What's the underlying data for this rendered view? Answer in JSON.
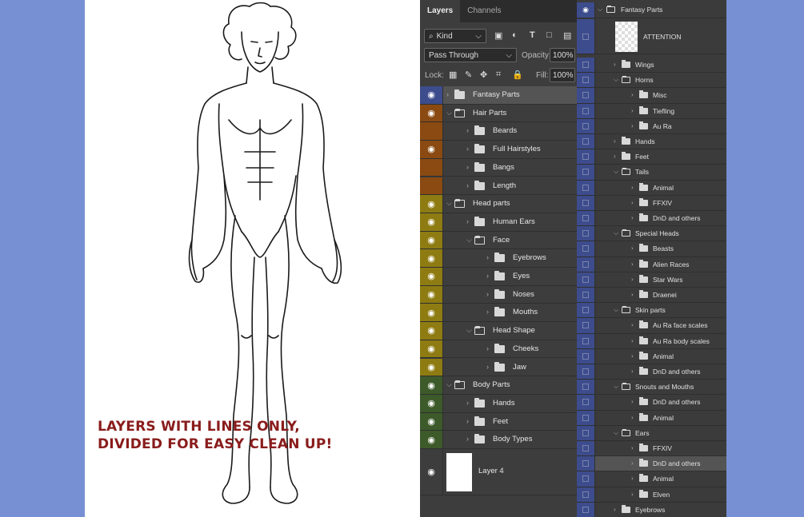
{
  "caption": {
    "line1": "LAYERS WITH LINES ONLY,",
    "line2": "DIVIDED FOR EASY CLEAN UP!"
  },
  "tabs": [
    "Layers",
    "Channels"
  ],
  "filter": {
    "kind": "Kind"
  },
  "blend": {
    "mode": "Pass Through",
    "opacity_label": "Opacity:",
    "opacity": "100%"
  },
  "lock": {
    "label": "Lock:",
    "fill_label": "Fill:",
    "fill": "100%"
  },
  "colors": {
    "blue": "#3d4c8c",
    "orange": "#8a4a12",
    "yellow": "#8e7c12",
    "green": "#3d5a2a"
  },
  "layers": [
    {
      "name": "Fantasy Parts",
      "depth": 0,
      "open": false,
      "color": "blue",
      "eye": true,
      "selected": true
    },
    {
      "name": "Hair Parts",
      "depth": 0,
      "open": true,
      "color": "orange",
      "eye": true
    },
    {
      "name": "Beards",
      "depth": 1,
      "open": false,
      "color": "orange",
      "eye": false
    },
    {
      "name": "Full Hairstyles",
      "depth": 1,
      "open": false,
      "color": "orange",
      "eye": true
    },
    {
      "name": "Bangs",
      "depth": 1,
      "open": false,
      "color": "orange",
      "eye": false
    },
    {
      "name": "Length",
      "depth": 1,
      "open": false,
      "color": "orange",
      "eye": false
    },
    {
      "name": "Head parts",
      "depth": 0,
      "open": true,
      "color": "yellow",
      "eye": true
    },
    {
      "name": "Human Ears",
      "depth": 1,
      "open": false,
      "color": "yellow",
      "eye": true
    },
    {
      "name": "Face",
      "depth": 1,
      "open": true,
      "color": "yellow",
      "eye": true
    },
    {
      "name": "Eyebrows",
      "depth": 2,
      "open": false,
      "color": "yellow",
      "eye": true
    },
    {
      "name": "Eyes",
      "depth": 2,
      "open": false,
      "color": "yellow",
      "eye": true
    },
    {
      "name": "Noses",
      "depth": 2,
      "open": false,
      "color": "yellow",
      "eye": true
    },
    {
      "name": "Mouths",
      "depth": 2,
      "open": false,
      "color": "yellow",
      "eye": true
    },
    {
      "name": "Head Shape",
      "depth": 1,
      "open": true,
      "color": "yellow",
      "eye": true
    },
    {
      "name": "Cheeks",
      "depth": 2,
      "open": false,
      "color": "yellow",
      "eye": true
    },
    {
      "name": "Jaw",
      "depth": 2,
      "open": false,
      "color": "yellow",
      "eye": true
    },
    {
      "name": "Body Parts",
      "depth": 0,
      "open": true,
      "color": "green",
      "eye": true
    },
    {
      "name": "Hands",
      "depth": 1,
      "open": false,
      "color": "green",
      "eye": true
    },
    {
      "name": "Feet",
      "depth": 1,
      "open": false,
      "color": "green",
      "eye": true
    },
    {
      "name": "Body Types",
      "depth": 1,
      "open": false,
      "color": "green",
      "eye": true
    }
  ],
  "bottom_layer": {
    "name": "Layer 4"
  },
  "panel2": {
    "header": "Fantasy Parts",
    "attention": "ATTENTION",
    "items": [
      {
        "name": "Wings",
        "depth": 0,
        "open": false
      },
      {
        "name": "Horns",
        "depth": 0,
        "open": true
      },
      {
        "name": "Misc",
        "depth": 1,
        "open": false
      },
      {
        "name": "Tiefling",
        "depth": 1,
        "open": false
      },
      {
        "name": "Au Ra",
        "depth": 1,
        "open": false
      },
      {
        "name": "Hands",
        "depth": 0,
        "open": false
      },
      {
        "name": "Feet",
        "depth": 0,
        "open": false
      },
      {
        "name": "Tails",
        "depth": 0,
        "open": true
      },
      {
        "name": "Animal",
        "depth": 1,
        "open": false
      },
      {
        "name": "FFXIV",
        "depth": 1,
        "open": false
      },
      {
        "name": "DnD and others",
        "depth": 1,
        "open": false
      },
      {
        "name": "Special Heads",
        "depth": 0,
        "open": true
      },
      {
        "name": "Beasts",
        "depth": 1,
        "open": false
      },
      {
        "name": "Alien Races",
        "depth": 1,
        "open": false
      },
      {
        "name": "Star Wars",
        "depth": 1,
        "open": false
      },
      {
        "name": "Draenei",
        "depth": 1,
        "open": false
      },
      {
        "name": "Skin parts",
        "depth": 0,
        "open": true
      },
      {
        "name": "Au Ra face scales",
        "depth": 1,
        "open": false
      },
      {
        "name": "Au Ra body scales",
        "depth": 1,
        "open": false
      },
      {
        "name": "Animal",
        "depth": 1,
        "open": false
      },
      {
        "name": "DnD and others",
        "depth": 1,
        "open": false
      },
      {
        "name": "Snouts and Mouths",
        "depth": 0,
        "open": true
      },
      {
        "name": "DnD and others",
        "depth": 1,
        "open": false
      },
      {
        "name": "Animal",
        "depth": 1,
        "open": false
      },
      {
        "name": "Ears",
        "depth": 0,
        "open": true
      },
      {
        "name": "FFXIV",
        "depth": 1,
        "open": false
      },
      {
        "name": "DnD and others",
        "depth": 1,
        "open": false,
        "selected": true
      },
      {
        "name": "Animal",
        "depth": 1,
        "open": false
      },
      {
        "name": "Elven",
        "depth": 1,
        "open": false
      },
      {
        "name": "Eyebrows",
        "depth": 0,
        "open": false
      }
    ]
  }
}
